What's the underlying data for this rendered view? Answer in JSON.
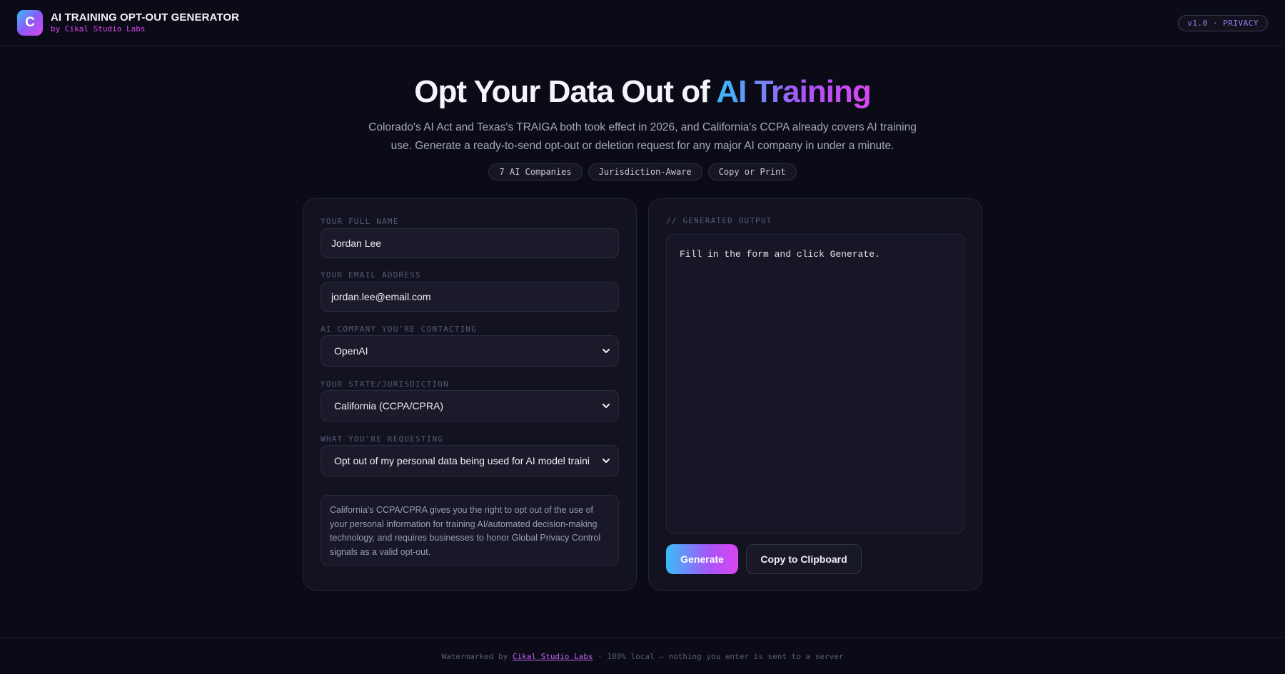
{
  "header": {
    "logo_letter": "C",
    "title": "AI TRAINING OPT-OUT GENERATOR",
    "subtitle": "by Cikal Studio Labs",
    "version_badge": "v1.0 · PRIVACY"
  },
  "hero": {
    "title_plain": "Opt Your Data Out of ",
    "title_accent": "AI Training",
    "description": "Colorado's AI Act and Texas's TRAIGA both took effect in 2026, and California's CCPA already covers AI training use. Generate a ready-to-send opt-out or deletion request for any major AI company in under a minute.",
    "chips": [
      "7 AI Companies",
      "Jurisdiction-Aware",
      "Copy or Print"
    ]
  },
  "form": {
    "name_label": "YOUR FULL NAME",
    "name_value": "Jordan Lee",
    "email_label": "YOUR EMAIL ADDRESS",
    "email_value": "jordan.lee@email.com",
    "company_label": "AI COMPANY YOU'RE CONTACTING",
    "company_value": "OpenAI",
    "state_label": "YOUR STATE/JURISDICTION",
    "state_value": "California (CCPA/CPRA)",
    "request_label": "WHAT YOU'RE REQUESTING",
    "request_value": "Opt out of my personal data being used for AI model training",
    "info_text": "California's CCPA/CPRA gives you the right to opt out of the use of your personal information for training AI/automated decision-making technology, and requires businesses to honor Global Privacy Control signals as a valid opt-out."
  },
  "output": {
    "label": "// GENERATED OUTPUT",
    "placeholder": "Fill in the form and click Generate.",
    "generate_label": "Generate",
    "copy_label": "Copy to Clipboard"
  },
  "footer": {
    "prefix": "Watermarked by ",
    "link_text": "Cikal Studio Labs",
    "suffix": " · 100% local — nothing you enter is sent to a server"
  },
  "colors": {
    "background": "#0b0b17",
    "accent_cyan": "#38bdf8",
    "accent_purple": "#a855f7",
    "accent_magenta": "#d946ef"
  }
}
